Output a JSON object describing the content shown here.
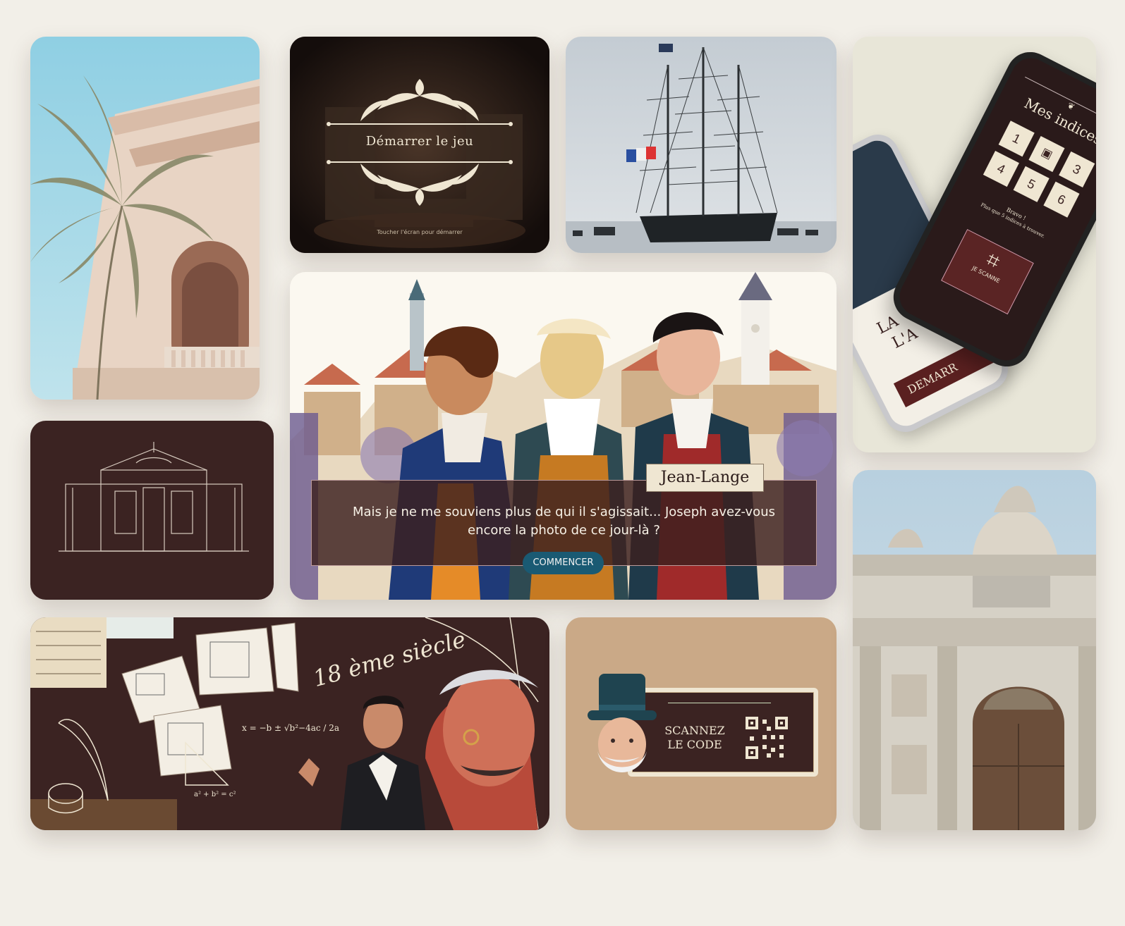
{
  "start_screen": {
    "title": "Démarrer le jeu",
    "hint": "Toucher l'écran pour démarrer"
  },
  "dialogue": {
    "speaker": "Jean-Lange",
    "line1": "Mais je ne me souviens plus de qui il s'agissait... Joseph avez-vous",
    "line2": "encore la photo de ce jour-là ?",
    "button": "COMMENCER"
  },
  "phone_app": {
    "title": "Mes indices",
    "clues": [
      "1",
      "3",
      "4",
      "5",
      "6"
    ],
    "bravo": "Bravo !",
    "remaining": "Plus que 5 indices à trouver.",
    "scan_button": "JE SCANNE",
    "back_title_1": "LA",
    "back_title_2": "L'A",
    "back_button": "DEMARR"
  },
  "math_board": {
    "title": "18 ème siècle",
    "formula": "x = −b ± √b²−4ac / 2a",
    "pythagore": "a² + b² = c²"
  },
  "scan_card": {
    "line1": "SCANNEZ",
    "line2": "LE CODE"
  },
  "colors": {
    "background": "#f2efe8",
    "burgundy": "#3b2322",
    "cream": "#efe6d2",
    "teal_button": "#1a5a73",
    "tan": "#caa987"
  }
}
